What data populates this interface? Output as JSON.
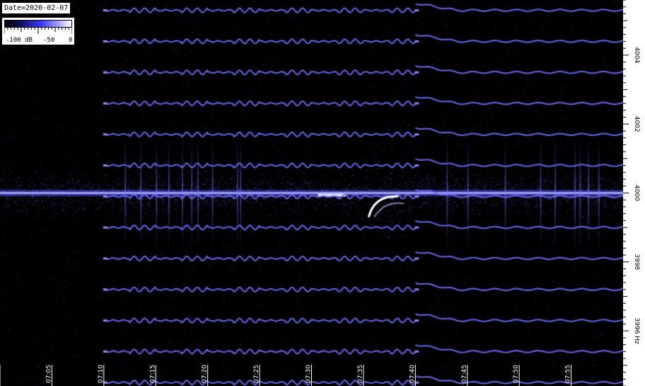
{
  "header": {
    "date_label": "Date=2020-02-07"
  },
  "legend": {
    "ticks": [
      "-100 dB",
      "-50",
      "0"
    ],
    "colors": [
      "#000000",
      "#10106a",
      "#3a3aff",
      "#9a9aff",
      "#ffffff"
    ]
  },
  "chart_data": {
    "type": "heatmap",
    "x_ticks": [
      "07:00",
      "07:05",
      "07:10",
      "07:15",
      "07:20",
      "07:25",
      "07:30",
      "07:35",
      "07:40",
      "07:45",
      "07:50",
      "07:55"
    ],
    "x_range": [
      "07:00",
      "08:00"
    ],
    "y_ticks": [
      "4004",
      "4002",
      "4000",
      "3998",
      "3996 Hz"
    ],
    "y_range": [
      3994.4,
      4005.6
    ],
    "color_scale": {
      "min": -100,
      "max": 0,
      "unit": "dB"
    },
    "features": [
      {
        "kind": "carrier",
        "freq": 4000.0,
        "segments": [
          [
            "07:00",
            "07:10.5"
          ],
          [
            "07:10.5",
            "07:40"
          ],
          [
            "07:40",
            "08:00"
          ]
        ]
      },
      {
        "kind": "modulated-lines",
        "start": "07:10",
        "end": "07:40",
        "spacing_hz": 0.9
      },
      {
        "kind": "modulated-lines",
        "start": "07:40",
        "end": "08:00",
        "spacing_hz": 0.9
      },
      {
        "kind": "bright-arc",
        "time": "07:37",
        "freq_top": 3999.9,
        "freq_bottom": 3999.3
      }
    ]
  }
}
